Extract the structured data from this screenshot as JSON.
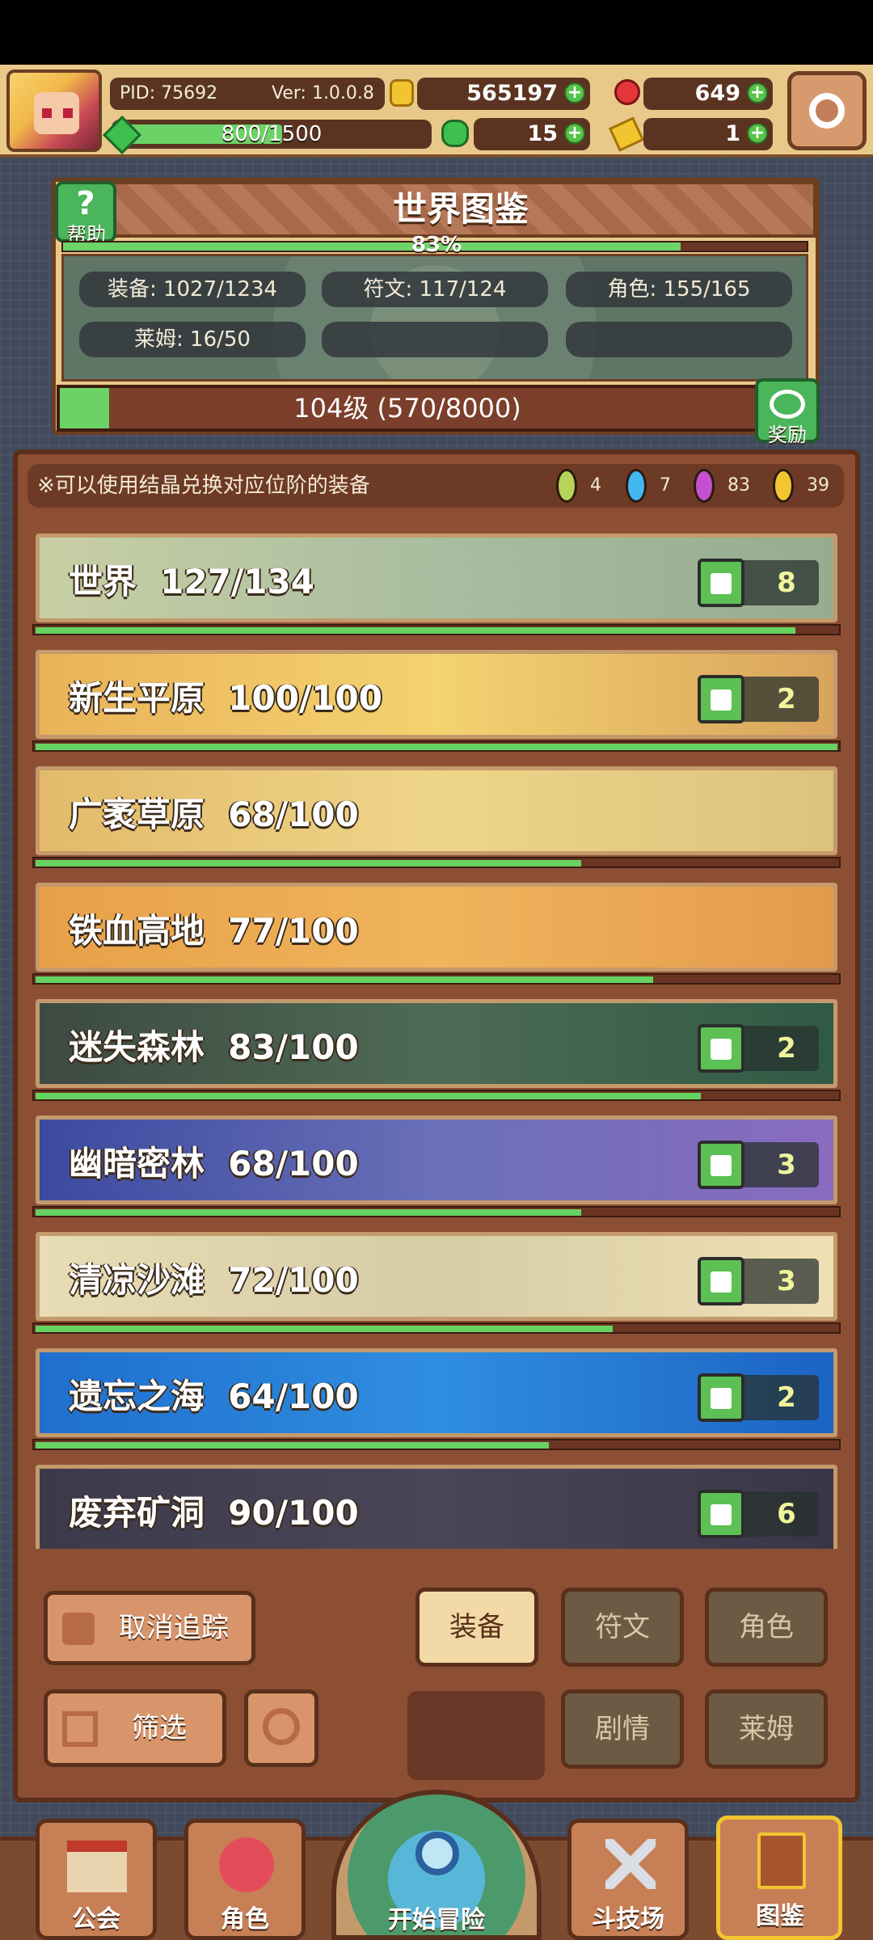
{
  "header": {
    "pid": "PID: 75692",
    "version": "Ver: 1.0.0.8",
    "exp_text": "800/1500",
    "exp_fraction": 0.533,
    "currencies": {
      "gold": "565197",
      "gems": "649",
      "clover": "15",
      "scroll": "1"
    }
  },
  "world_card": {
    "title": "世界图鉴",
    "help_label": "帮助",
    "percent_text": "83%",
    "percent": 0.83,
    "stats": [
      "装备: 1027/1234",
      "符文: 117/124",
      "角色: 155/165",
      "莱姆: 16/50"
    ],
    "level_text": "104级  (570/8000)",
    "level_fraction": 0.071,
    "reward_label": "奖励"
  },
  "notice": "※可以使用结晶兑换对应位阶的装备",
  "crystals": [
    {
      "color": "#b7d45a",
      "count": "4"
    },
    {
      "color": "#43b7f0",
      "count": "7"
    },
    {
      "color": "#c54fd1",
      "count": "83"
    },
    {
      "color": "#f2c530",
      "count": "39"
    }
  ],
  "regions": [
    {
      "name": "世界  127/134",
      "progress": 0.948,
      "likes": "8",
      "bg": "linear-gradient(90deg,#c8cfa4,#a9bda0 50%,#97ac8f)"
    },
    {
      "name": "新生平原  100/100",
      "progress": 1.0,
      "likes": "2",
      "bg": "linear-gradient(90deg,#e9b259,#f4d370 50%,#d8a45c)"
    },
    {
      "name": "广袤草原  68/100",
      "progress": 0.68,
      "likes": "",
      "bg": "linear-gradient(90deg,#e2ba6a,#efd589 50%,#dcc27c)"
    },
    {
      "name": "铁血高地  77/100",
      "progress": 0.77,
      "likes": "",
      "bg": "linear-gradient(90deg,#e7a048,#f0b45c 50%,#e49a4c)"
    },
    {
      "name": "迷失森林  83/100",
      "progress": 0.83,
      "likes": "2",
      "bg": "linear-gradient(90deg,#3d4a42,#4e6b55 50%,#2f5a45)"
    },
    {
      "name": "幽暗密林  68/100",
      "progress": 0.68,
      "likes": "3",
      "bg": "linear-gradient(90deg,#3b4aa0,#6a70b8 50%,#8a6bbf)"
    },
    {
      "name": "清凉沙滩  72/100",
      "progress": 0.72,
      "likes": "3",
      "bg": "linear-gradient(90deg,#e8dcb4,#d6cca6 50%,#efe0b4)"
    },
    {
      "name": "遗忘之海  64/100",
      "progress": 0.64,
      "likes": "2",
      "bg": "linear-gradient(90deg,#1f6fcf,#2f8ee0 50%,#1c63c4)"
    },
    {
      "name": "废弃矿洞  90/100",
      "progress": 0.9,
      "likes": "6",
      "bg": "linear-gradient(90deg,#3c3a4a,#4a4658 50%,#3a3648)"
    }
  ],
  "controls": {
    "untrack": "取消追踪",
    "filter": "筛选",
    "tabs": {
      "equipment": "装备",
      "rune": "符文",
      "character": "角色",
      "story": "剧情",
      "slime": "莱姆"
    }
  },
  "nav": {
    "guild": "公会",
    "character": "角色",
    "adventure": "开始冒险",
    "arena": "斗技场",
    "codex": "图鉴"
  }
}
